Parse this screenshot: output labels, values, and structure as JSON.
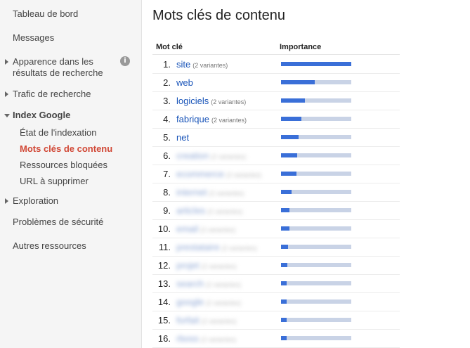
{
  "sidebar": {
    "items": [
      {
        "label": "Tableau de bord"
      },
      {
        "label": "Messages"
      },
      {
        "label_line1": "Apparence dans les",
        "label_line2": "résultats de recherche"
      },
      {
        "label": "Trafic de recherche"
      },
      {
        "label": "Index Google"
      },
      {
        "label": "Exploration"
      },
      {
        "label": "Problèmes de sécurité"
      },
      {
        "label": "Autres ressources"
      }
    ],
    "subitems": [
      {
        "label": "État de l'indexation"
      },
      {
        "label": "Mots clés de contenu"
      },
      {
        "label": "Ressources bloquées"
      },
      {
        "label": "URL à supprimer"
      }
    ],
    "info_icon": "i"
  },
  "main": {
    "title": "Mots clés de contenu",
    "columns": {
      "keyword": "Mot clé",
      "importance": "Importance"
    },
    "rows": [
      {
        "num": "1.",
        "keyword": "site",
        "variants": "(2 variantes)",
        "importance": 1.0,
        "blurred": false
      },
      {
        "num": "2.",
        "keyword": "web",
        "variants": "",
        "importance": 0.48,
        "blurred": false
      },
      {
        "num": "3.",
        "keyword": "logiciels",
        "variants": "(2 variantes)",
        "importance": 0.34,
        "blurred": false
      },
      {
        "num": "4.",
        "keyword": "fabrique",
        "variants": "(2 variantes)",
        "importance": 0.29,
        "blurred": false
      },
      {
        "num": "5.",
        "keyword": "net",
        "variants": "",
        "importance": 0.25,
        "blurred": false
      },
      {
        "num": "6.",
        "keyword": "creation",
        "variants": "(2 variantes)",
        "importance": 0.23,
        "blurred": true
      },
      {
        "num": "7.",
        "keyword": "ecommerce",
        "variants": "(2 variantes)",
        "importance": 0.22,
        "blurred": true
      },
      {
        "num": "8.",
        "keyword": "internet",
        "variants": "(2 variantes)",
        "importance": 0.15,
        "blurred": true
      },
      {
        "num": "9.",
        "keyword": "articles",
        "variants": "(2 variantes)",
        "importance": 0.12,
        "blurred": true
      },
      {
        "num": "10.",
        "keyword": "email",
        "variants": "(2 variantes)",
        "importance": 0.12,
        "blurred": true
      },
      {
        "num": "11.",
        "keyword": "prestataire",
        "variants": "(2 variantes)",
        "importance": 0.1,
        "blurred": true
      },
      {
        "num": "12.",
        "keyword": "projet",
        "variants": "(2 variantes)",
        "importance": 0.09,
        "blurred": true
      },
      {
        "num": "13.",
        "keyword": "search",
        "variants": "(2 variantes)",
        "importance": 0.08,
        "blurred": true
      },
      {
        "num": "14.",
        "keyword": "google",
        "variants": "(2 variantes)",
        "importance": 0.08,
        "blurred": true
      },
      {
        "num": "15.",
        "keyword": "forfait",
        "variants": "(2 variantes)",
        "importance": 0.08,
        "blurred": true
      },
      {
        "num": "16.",
        "keyword": "rboss",
        "variants": "(2 variantes)",
        "importance": 0.08,
        "blurred": true
      }
    ]
  },
  "colors": {
    "accent_red": "#d14836",
    "link_blue": "#1a55b9",
    "bar_fill": "#3a6fd8",
    "bar_track": "#c9d3e6"
  }
}
